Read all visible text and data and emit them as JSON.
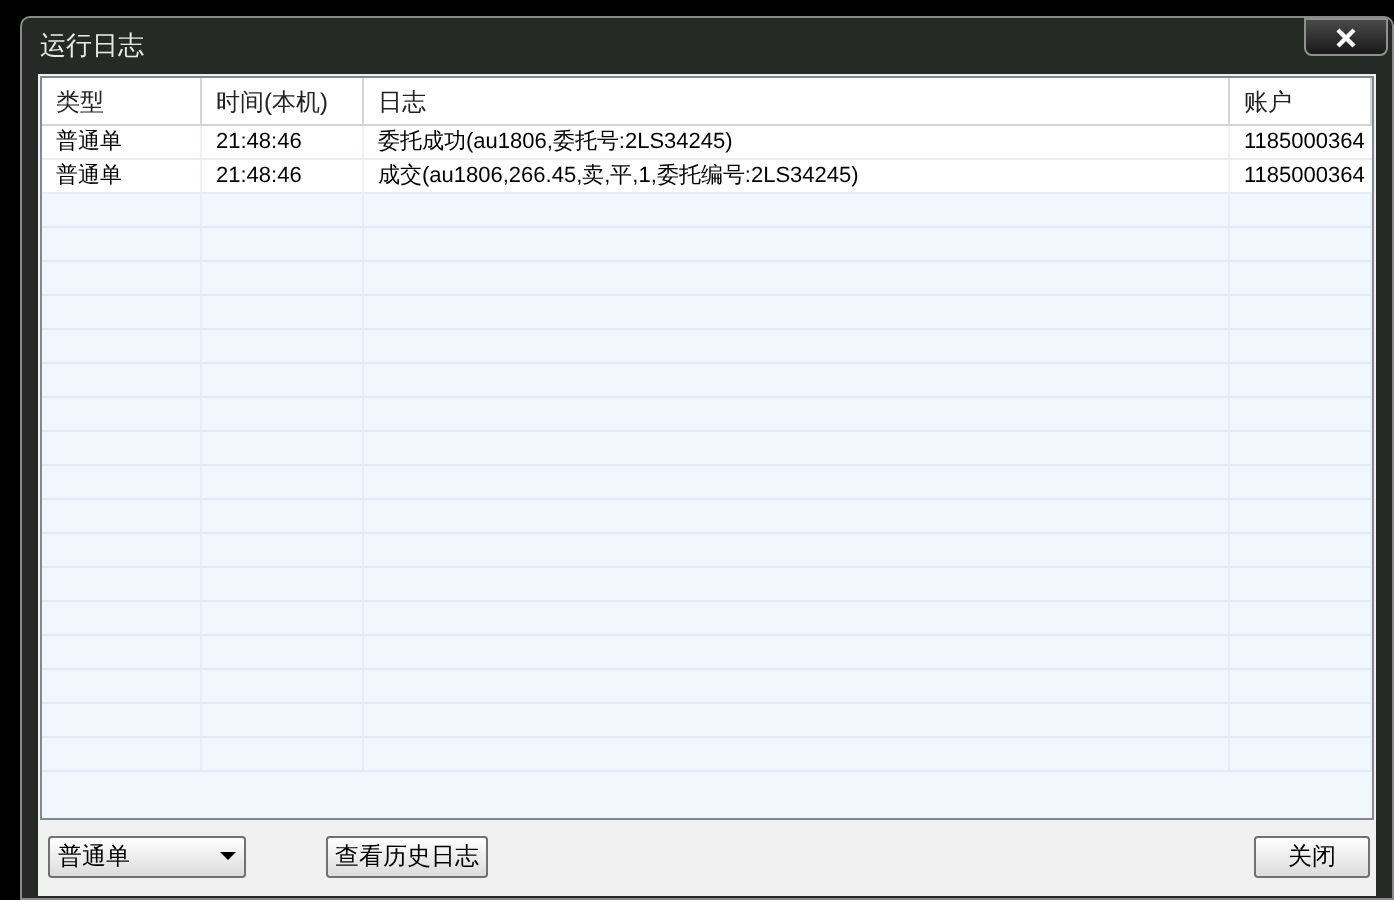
{
  "window": {
    "title": "运行日志"
  },
  "table": {
    "columns": [
      "类型",
      "时间(本机)",
      "日志",
      "账户"
    ],
    "rows": [
      [
        "普通单",
        "21:48:46",
        "委托成功(au1806,委托号:2LS34245)",
        "1185000364"
      ],
      [
        "普通单",
        "21:48:46",
        "成交(au1806,266.45,卖,平,1,委托编号:2LS34245)",
        "1185000364"
      ]
    ]
  },
  "footer": {
    "filter": "普通单",
    "history_button": "查看历史日志",
    "close_button": "关闭"
  }
}
